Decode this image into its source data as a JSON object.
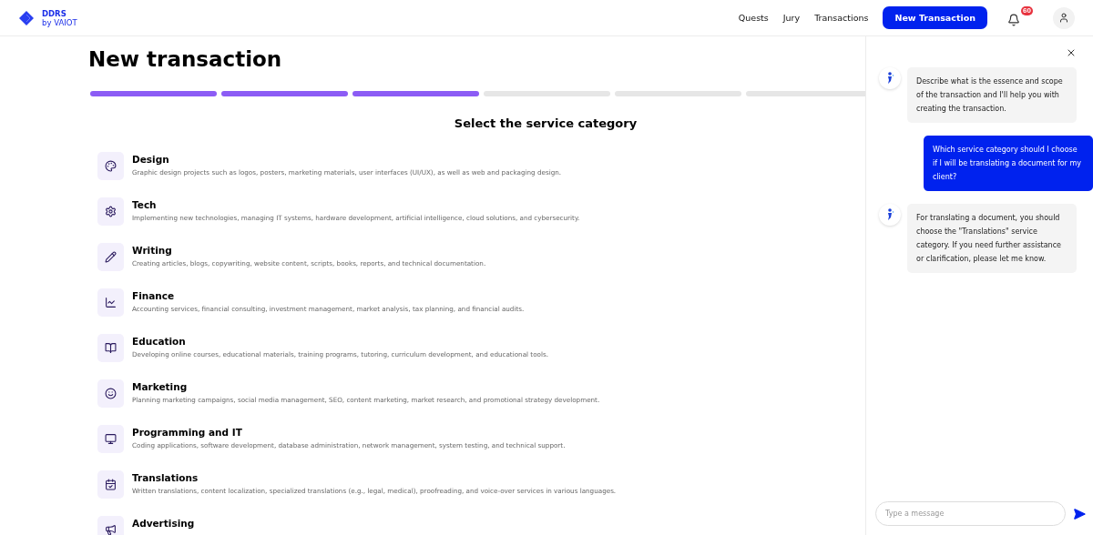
{
  "header": {
    "logo": {
      "title": "DDRS",
      "subtitle": "by VAIOT"
    },
    "nav": [
      "Quests",
      "Jury",
      "Transactions"
    ],
    "cta": "New Transaction",
    "notifications": "60"
  },
  "page": {
    "title": "New transaction",
    "steps": [
      {
        "done": true
      },
      {
        "done": true
      },
      {
        "done": true
      },
      {
        "done": false
      },
      {
        "done": false
      },
      {
        "done": false
      }
    ],
    "subtitle": "Select the service category",
    "categories": [
      {
        "name": "Design",
        "description": "Graphic design projects such as logos, posters, marketing materials, user interfaces (UI/UX), as well as web and packaging design."
      },
      {
        "name": "Tech",
        "description": "Implementing new technologies, managing IT systems, hardware development, artificial intelligence, cloud solutions, and cybersecurity."
      },
      {
        "name": "Writing",
        "description": "Creating articles, blogs, copywriting, website content, scripts, books, reports, and technical documentation."
      },
      {
        "name": "Finance",
        "description": "Accounting services, financial consulting, investment management, market analysis, tax planning, and financial audits."
      },
      {
        "name": "Education",
        "description": "Developing online courses, educational materials, training programs, tutoring, curriculum development, and educational tools."
      },
      {
        "name": "Marketing",
        "description": "Planning marketing campaigns, social media management, SEO, content marketing, market research, and promotional strategy development."
      },
      {
        "name": "Programming and IT",
        "description": "Coding applications, software development, database administration, network management, system testing, and technical support."
      },
      {
        "name": "Translations",
        "description": "Written translations, content localization, specialized translations (e.g., legal, medical), proofreading, and voice-over services in various languages."
      },
      {
        "name": "Advertising"
      }
    ]
  },
  "chat": {
    "messages": [
      {
        "kind": "bot",
        "text": "Describe what is the essence and scope of the transaction and I'll help you with creating the transaction."
      },
      {
        "kind": "user",
        "text": "Which service category should I choose if I will be translating a document for my client?"
      },
      {
        "kind": "bot",
        "text": "For translating a document, you should choose the \"Translations\" service category. If you need further assistance or clarification, please let me know."
      }
    ],
    "input": {
      "placeholder": "Type a message"
    }
  }
}
